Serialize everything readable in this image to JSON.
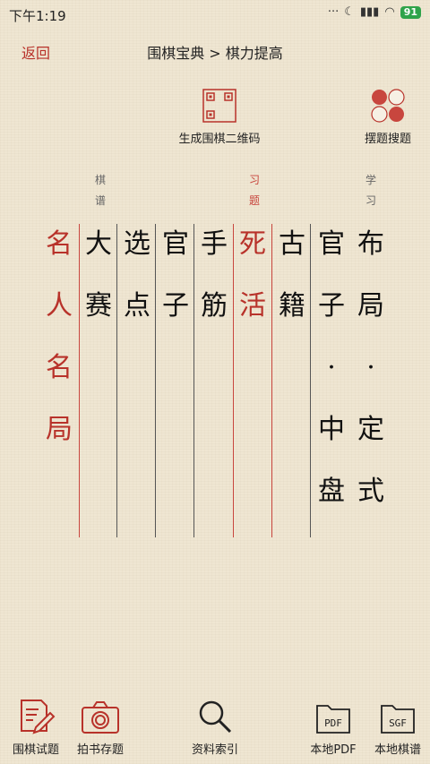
{
  "status": {
    "time": "下午1:19",
    "battery": "91"
  },
  "header": {
    "back_label": "返回",
    "title": "围棋宝典 > 棋力提高"
  },
  "tools": {
    "qr_label": "生成围棋二维码",
    "search_label": "摆题搜题"
  },
  "columns": [
    {
      "chars": [
        "名",
        "人",
        "名",
        "局"
      ],
      "red": true
    },
    {
      "chars": [
        "大",
        "赛"
      ],
      "red": false
    },
    {
      "chars": [
        "选",
        "点"
      ],
      "red": false
    },
    {
      "chars": [
        "官",
        "子"
      ],
      "red": false
    },
    {
      "chars": [
        "手",
        "筋"
      ],
      "red": false
    },
    {
      "chars": [
        "死",
        "活"
      ],
      "red": true
    },
    {
      "chars": [
        "古",
        "籍"
      ],
      "red": false
    },
    {
      "chars": [
        "官",
        "子",
        "·",
        "中",
        "盘"
      ],
      "red": false
    },
    {
      "chars": [
        "布",
        "局",
        "·",
        "定",
        "式"
      ],
      "red": false
    }
  ],
  "section_labels": [
    {
      "text": "棋谱",
      "red": false
    },
    {
      "text": "习题",
      "red": true
    },
    {
      "text": "学习",
      "red": false
    }
  ],
  "bottom_nav": [
    {
      "label": "围棋试题",
      "icon": "pen-paper-icon"
    },
    {
      "label": "拍书存题",
      "icon": "camera-icon"
    },
    {
      "label": "资料索引",
      "icon": "magnifier-icon"
    },
    {
      "label": "本地PDF",
      "icon": "pdf-folder-icon",
      "badge": "PDF"
    },
    {
      "label": "本地棋谱",
      "icon": "sgf-folder-icon",
      "badge": "SGF"
    }
  ],
  "colors": {
    "accent_red": "#b8322a",
    "battery_green": "#2fa34a",
    "background": "#efe6d2"
  }
}
